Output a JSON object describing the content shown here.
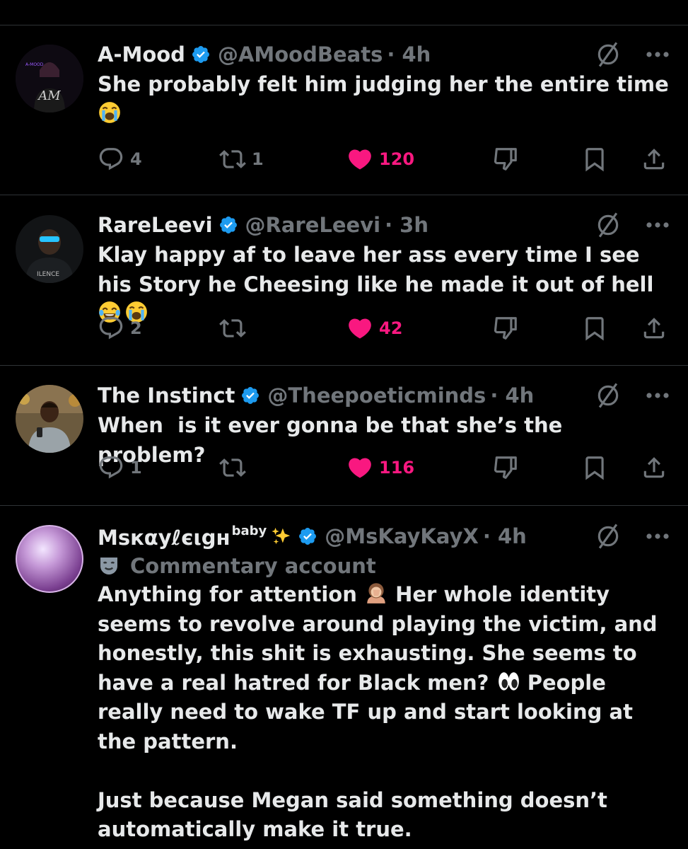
{
  "colors": {
    "background": "#000000",
    "divider": "#2f3336",
    "verified_blue": "#1d9bf0",
    "like_pink": "#f91880",
    "muted_gray": "#71767b",
    "text": "#e7e9ea"
  },
  "tweets": [
    {
      "name": "A-Mood",
      "handle": "@AMoodBeats",
      "time": "· 4h",
      "verified": true,
      "text": "She probably felt him judging her the entire time",
      "emojis": [
        "loudly-crying-face"
      ],
      "counts": {
        "replies": "4",
        "reposts": "1",
        "likes": "120"
      },
      "liked": true,
      "avatar_label": "AM",
      "avatar_tag": "A-MOOD"
    },
    {
      "name": "RareLeevi",
      "handle": "@RareLeevi",
      "time": "· 3h",
      "verified": true,
      "text": "Klay happy af to leave her ass every time I see his Story he Cheesing like he made it out of hell",
      "emojis": [
        "face-with-tears-of-joy",
        "loudly-crying-face"
      ],
      "counts": {
        "replies": "2",
        "reposts": "",
        "likes": "42"
      },
      "liked": true,
      "avatar_label": "ILENCE"
    },
    {
      "name": "The Instinct",
      "handle": "@Theepoeticminds",
      "time": "· 4h",
      "verified": true,
      "text": "When  is it ever gonna be that she’s the problem?",
      "counts": {
        "replies": "1",
        "reposts": "",
        "likes": "116"
      },
      "liked": true
    },
    {
      "name": "Msкαуℓєιgн",
      "name_sup": "baby",
      "name_emoji": "sparkles",
      "handle": "@MsKayKayX",
      "time": "· 4h",
      "verified": true,
      "commentary_label": "Commentary account",
      "text_part1": "Anything for attention ",
      "text_part1_emoji": "woman-facepalming",
      "text_part2": " Her whole identity seems to revolve around playing the victim, and honestly, this shit is exhausting. She seems to have a real hatred for Black men? ",
      "text_part2_emoji": "eyes",
      "text_part3": " People really need to wake TF up and start looking at the pattern.",
      "text_para2": "Just because Megan said something doesn’t automatically make it true."
    }
  ],
  "icons": {
    "reply": "reply-icon",
    "repost": "repost-icon",
    "like": "heart-icon",
    "dislike": "thumbs-down-icon",
    "bookmark": "bookmark-icon",
    "share": "share-icon",
    "mute": "no-symbol-icon",
    "more": "more-icon",
    "verified": "verified-badge-icon",
    "commentary": "theater-mask-icon"
  }
}
